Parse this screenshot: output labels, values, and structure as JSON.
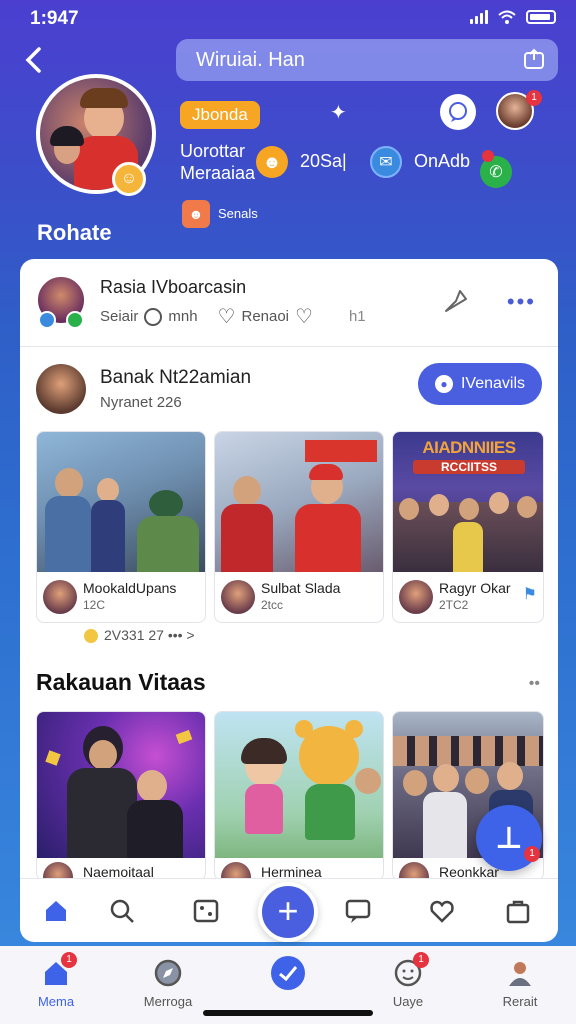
{
  "status_bar": {
    "time": "1:947"
  },
  "header": {
    "search_text": "Wiruiai. Han",
    "profile_name": "Rohate",
    "tag": "Jbonda",
    "stat_left": [
      "Uorottar",
      "Meraaiaa"
    ],
    "stat_mid": "20Sa|",
    "stat_right": "OnAdb",
    "mini_label": "Senals"
  },
  "post": {
    "title": "Rasia IVboarcasin",
    "meta_time": "Seiair",
    "meta_min": "mnh",
    "meta_react": "Renaoi",
    "meta_count": "h1"
  },
  "section2": {
    "title": "Banak Nt22amian",
    "subtitle": "Nyranet 226",
    "button_label": "IVenavils",
    "tiles": [
      {
        "title": "MookaldUpans",
        "sub": "12C"
      },
      {
        "title": "Sulbat Slada",
        "sub": "2tcc"
      },
      {
        "title": "Ragyr Okar",
        "sub": "2TC2"
      }
    ],
    "poster_text": [
      "AIADNNIIES",
      "RCCIITSS"
    ],
    "meta_row": "2V331 27 ••• >"
  },
  "section3": {
    "title": "Rakauan Vitaas",
    "tiles": [
      {
        "title": "Naemoitaal"
      },
      {
        "title": "Herminea"
      },
      {
        "title": "Reonkkar"
      }
    ]
  },
  "bottom_nav": {
    "items": [
      {
        "label": "Mema",
        "icon": "home-icon",
        "badge": "1"
      },
      {
        "label": "Merroga",
        "icon": "compass-icon"
      },
      {
        "label": "",
        "icon": "check-circle-icon"
      },
      {
        "label": "Uaye",
        "icon": "face-icon",
        "badge": "1"
      },
      {
        "label": "Rerait",
        "icon": "user-icon"
      }
    ]
  },
  "colors": {
    "accent": "#4a5ee0",
    "badge": "#e5333f",
    "tag": "#f6a623"
  }
}
